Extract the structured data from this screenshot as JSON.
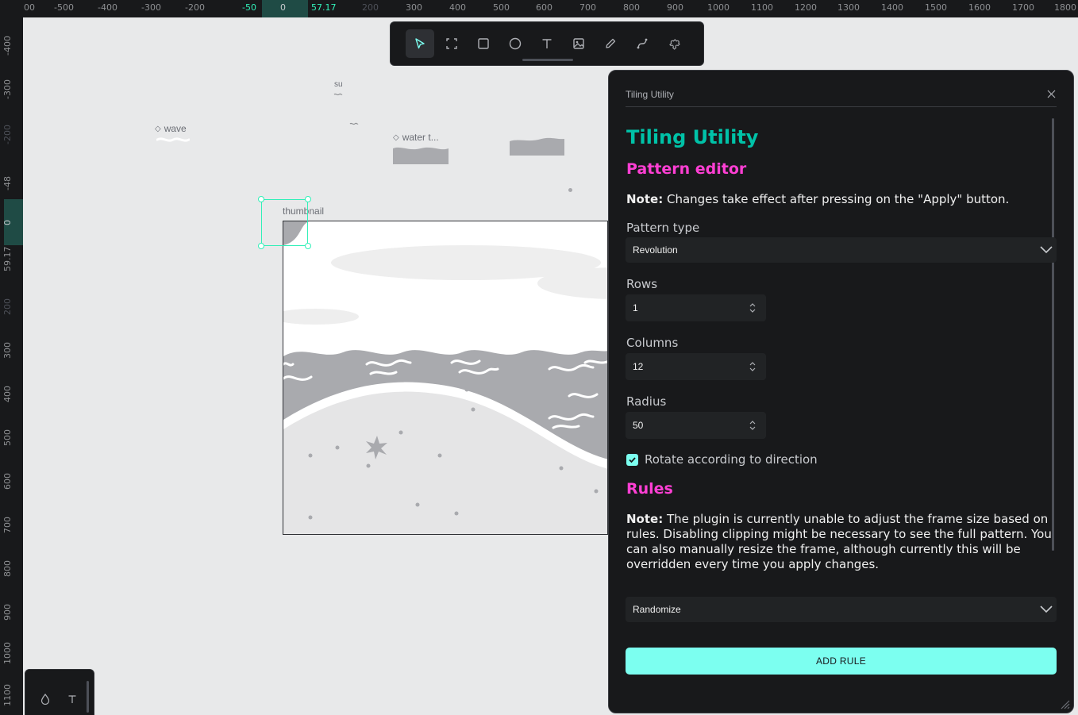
{
  "rulers": {
    "top_ticks": [
      "00",
      "-500",
      "-400",
      "-300",
      "-200",
      "-50",
      "0",
      "57.17",
      "200",
      "300",
      "400",
      "500",
      "600",
      "700",
      "800",
      "900",
      "1000",
      "1100",
      "1200",
      "1300",
      "1400",
      "1500",
      "1600",
      "1700",
      "1800"
    ],
    "left_ticks": [
      "-400",
      "-300",
      "-200",
      "-48",
      "0",
      "59.17",
      "200",
      "300",
      "400",
      "500",
      "600",
      "700",
      "800",
      "900",
      "1000",
      "1100"
    ]
  },
  "toolbar": {
    "tools": [
      {
        "name": "move-tool",
        "icon": "pointer-icon"
      },
      {
        "name": "board-tool",
        "icon": "board-icon"
      },
      {
        "name": "rectangle-tool",
        "icon": "rectangle-icon"
      },
      {
        "name": "ellipse-tool",
        "icon": "ellipse-icon"
      },
      {
        "name": "text-tool",
        "icon": "text-icon"
      },
      {
        "name": "image-tool",
        "icon": "image-icon"
      },
      {
        "name": "pencil-tool",
        "icon": "pencil-icon"
      },
      {
        "name": "path-tool",
        "icon": "path-icon"
      },
      {
        "name": "plugins-tool",
        "icon": "puzzle-icon"
      }
    ]
  },
  "canvas": {
    "layers": {
      "wave": "wave",
      "water": "water t...",
      "su": "su",
      "thumbnail": "thumbnail"
    }
  },
  "plugin": {
    "header_title": "Tiling Utility",
    "title": "Tiling Utility",
    "pattern_editor_heading": "Pattern editor",
    "note1_label": "Note:",
    "note1_text": " Changes take effect after pressing on the \"Apply\" button.",
    "pattern_type_label": "Pattern type",
    "pattern_type_value": "Revolution",
    "rows_label": "Rows",
    "rows_value": "1",
    "columns_label": "Columns",
    "columns_value": "12",
    "radius_label": "Radius",
    "radius_value": "50",
    "rotate_label": "Rotate according to direction",
    "rotate_checked": true,
    "rules_heading": "Rules",
    "note2_label": "Note:",
    "note2_text": " The plugin is currently unable to adjust the frame size based on rules. Disabling clipping might be necessary to see the full pattern. You can also manually resize the frame, although currently this will be overridden every time you apply changes.",
    "rule_type_value": "Randomize",
    "add_rule_label": "ADD RULE"
  },
  "colors": {
    "accent_teal": "#00c2a8",
    "accent_pink": "#ff3fd4",
    "button_cyan": "#7cfff0",
    "selection": "#31efb8"
  }
}
